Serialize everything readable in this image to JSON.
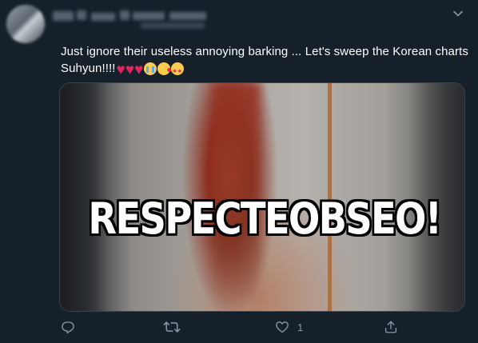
{
  "tweet": {
    "text": "Just ignore their useless annoying barking ... Let's sweep the Korean charts Suhyun!!!!",
    "emojis": [
      "red-heart",
      "red-heart",
      "red-heart",
      "loudly-crying-face",
      "face-blowing-kiss",
      "star-struck"
    ],
    "meme_text": "RESPECTEOBSEO!"
  },
  "actions": {
    "reply_icon": "reply-icon",
    "retweet_icon": "retweet-icon",
    "like_icon": "heart-icon",
    "share_icon": "share-icon",
    "like_count": "1"
  },
  "colors": {
    "background": "#15202b",
    "text": "#ffffff",
    "icon": "#8899a6",
    "border": "#38444d"
  }
}
